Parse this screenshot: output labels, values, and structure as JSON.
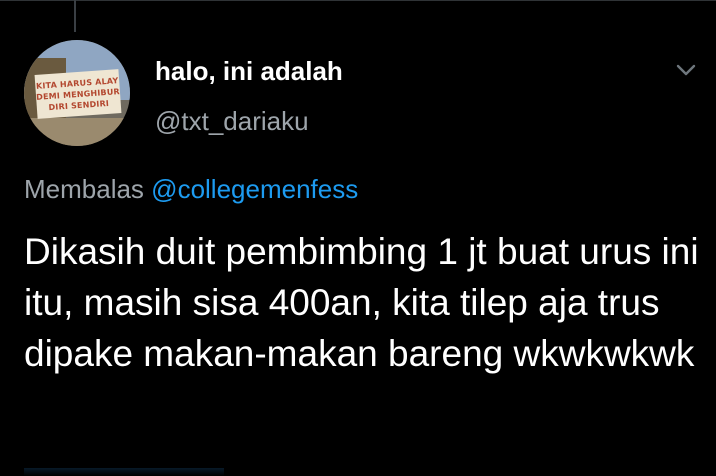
{
  "tweet": {
    "display_name": "halo, ini adalah",
    "handle": "@txt_dariaku",
    "reply_prefix": "Membalas",
    "reply_mention": "@collegemenfess",
    "text": "Dikasih duit pembimbing 1 jt buat urus ini itu, masih sisa 400an, kita tilep aja trus dipake makan-makan bareng wkwkwkwk"
  },
  "avatar": {
    "sign_lines": [
      "KITA HARUS ALAY",
      "DEMI MENGHIBUR",
      "DIRI SENDIRI"
    ]
  },
  "icons": {
    "menu": "chevron-down-icon"
  },
  "colors": {
    "background": "#000000",
    "primary_text": "#ffffff",
    "secondary_text": "#9ea5ab",
    "link": "#1d9bf0"
  }
}
